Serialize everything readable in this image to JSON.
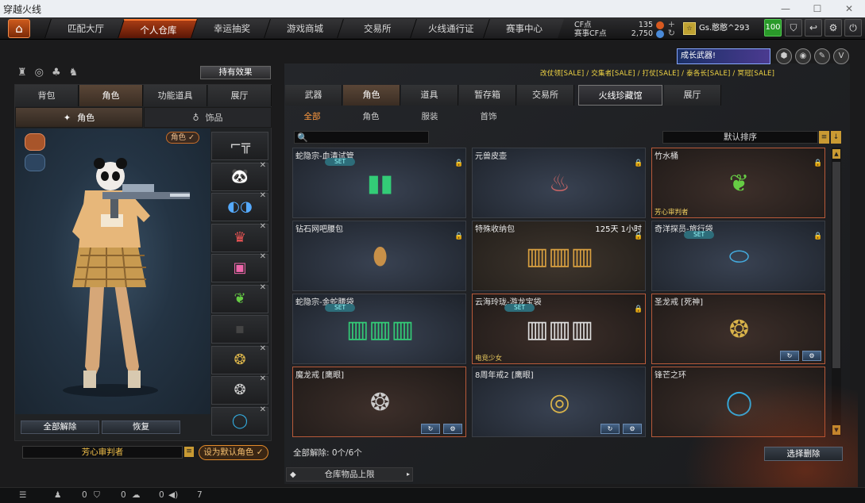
{
  "window": {
    "title": "穿越火线",
    "minimize": "—",
    "maximize": "☐",
    "close": "✕"
  },
  "topnav": {
    "home_icon": "⌂",
    "tabs": [
      "匹配大厅",
      "个人仓库",
      "幸运抽奖",
      "游戏商城",
      "交易所",
      "火线通行证",
      "赛事中心"
    ],
    "active_tab": "个人仓库"
  },
  "currency": {
    "cf_label": "CF点",
    "cf_value": "135",
    "event_label": "赛事CF点",
    "event_value": "2,750",
    "plus": "+",
    "refresh": "↻"
  },
  "user": {
    "name": "Gs.憨憨^293",
    "avatar": "☆",
    "level": "100"
  },
  "toolbar_icons": [
    "shield-icon",
    "back-icon",
    "gear-icon",
    "power-icon"
  ],
  "toolbar_glyphs": [
    "⛉",
    "↩",
    "⚙",
    "⏻"
  ],
  "left": {
    "small_icons": [
      "♜",
      "◎",
      "♣",
      "♞"
    ],
    "effect_button": "持有效果",
    "tabs": [
      "背包",
      "角色",
      "功能道具",
      "展厅"
    ],
    "active_tab": "角色",
    "subtabs": [
      "角色",
      "饰品"
    ],
    "subtab_icons": [
      "✦",
      "♁"
    ],
    "badge": "角色 ✓",
    "release_all": "全部解除",
    "restore": "恢复",
    "character_name": "芳心审判者",
    "name_menu_icon": "≡",
    "set_default": "设为默认角色 ✓",
    "equip_slots": [
      {
        "name": "rifle-slot",
        "glyph": "⌐╦",
        "color": "#ccc",
        "close": ""
      },
      {
        "name": "panda-head-slot",
        "glyph": "🐼",
        "color": "#fff",
        "close": "✕"
      },
      {
        "name": "goggles-slot",
        "glyph": "◐◑",
        "color": "#5af",
        "close": "✕"
      },
      {
        "name": "mask-slot",
        "glyph": "♛",
        "color": "#e55",
        "close": "✕"
      },
      {
        "name": "backpack-slot",
        "glyph": "▣",
        "color": "#e6a",
        "close": "✕"
      },
      {
        "name": "bamboo-slot",
        "glyph": "❦",
        "color": "#6c4",
        "close": "✕"
      },
      {
        "name": "empty-slot",
        "glyph": "▪",
        "color": "#444",
        "close": ""
      },
      {
        "name": "dragon-ring-gold-slot",
        "glyph": "❂",
        "color": "#d9b34a",
        "close": "✕"
      },
      {
        "name": "dragon-ring-silver-slot",
        "glyph": "❂",
        "color": "#ccc",
        "close": "✕"
      },
      {
        "name": "blue-ring-slot",
        "glyph": "◯",
        "color": "#3ad",
        "close": "✕"
      }
    ]
  },
  "right": {
    "promo": "成长武器!",
    "ticker": "改仗领[SALE] / 交集者[SALE] / 打仗[SALE] / 泰各长[SALE] / 冥冠[SALE]",
    "tabs": [
      "武器",
      "角色",
      "道具",
      "暂存箱",
      "交易所",
      "火线珍藏馆",
      "展厅"
    ],
    "active_tab": "角色",
    "subtabs": [
      "全部",
      "角色",
      "服装",
      "首饰"
    ],
    "active_subtab": "全部",
    "search_icon": "🔍",
    "search_placeholder": "",
    "sort": "默认排序",
    "sort_icons": [
      "≡",
      "↓"
    ],
    "items": [
      {
        "name": "蛇隐宗-血清试管",
        "set": "SET",
        "lock": "🔒",
        "glyph": "▮▮",
        "color": "#3c7",
        "time": "",
        "tag": "",
        "style": "",
        "actions": []
      },
      {
        "name": "元兽皮壶",
        "set": "",
        "lock": "🔒",
        "glyph": "♨",
        "color": "#c66",
        "time": "",
        "tag": "",
        "style": "",
        "actions": []
      },
      {
        "name": "竹水桶",
        "set": "",
        "lock": "🔒",
        "glyph": "❦",
        "color": "#6c4",
        "time": "",
        "tag": "芳心审判者",
        "style": "red",
        "actions": []
      },
      {
        "name": "钻石网吧腰包",
        "set": "",
        "lock": "🔒",
        "glyph": "⬮",
        "color": "#c89048",
        "time": "",
        "tag": "",
        "style": "",
        "actions": []
      },
      {
        "name": "特殊收纳包",
        "set": "",
        "lock": "🔒",
        "glyph": "▥▥▥",
        "color": "#d9a040",
        "time": "125天 1小时",
        "tag": "",
        "style": "brown",
        "actions": []
      },
      {
        "name": "奇洋探员-旅行袋",
        "set": "SET",
        "lock": "🔒",
        "glyph": "⬭",
        "color": "#4ad",
        "time": "",
        "tag": "",
        "style": "",
        "actions": []
      },
      {
        "name": "蛇隐宗-金蛇腰袋",
        "set": "SET",
        "lock": "",
        "glyph": "▥▥▥",
        "color": "#3c7",
        "time": "",
        "tag": "",
        "style": "",
        "actions": []
      },
      {
        "name": "云海玲珑-游龙宝袋",
        "set": "SET",
        "lock": "🔒",
        "glyph": "▥▥▥",
        "color": "#ddd",
        "time": "",
        "tag": "电竞少女",
        "style": "red",
        "actions": []
      },
      {
        "name": "圣龙戒 [死神]",
        "set": "",
        "lock": "",
        "glyph": "❂",
        "color": "#d9b34a",
        "time": "",
        "tag": "",
        "style": "red",
        "actions": [
          "↻",
          "⚙"
        ]
      },
      {
        "name": "魔龙戒 [鹰眼]",
        "set": "",
        "lock": "",
        "glyph": "❂",
        "color": "#ccc",
        "time": "",
        "tag": "",
        "style": "red",
        "actions": [
          "↻",
          "⚙"
        ]
      },
      {
        "name": "8周年戒2 [鹰眼]",
        "set": "",
        "lock": "",
        "glyph": "◎",
        "color": "#d9b34a",
        "time": "",
        "tag": "",
        "style": "",
        "actions": [
          "↻",
          "⚙"
        ]
      },
      {
        "name": "锋芒之环",
        "set": "",
        "lock": "",
        "glyph": "◯",
        "color": "#3ad",
        "time": "",
        "tag": "",
        "style": "red",
        "actions": []
      }
    ],
    "scroll_up": "▲",
    "scroll_down": "▼",
    "release_info": "全部解除: 0个/6个",
    "select_delete": "选择删除",
    "capacity": "仓库物品上限",
    "capacity_icon": "◆",
    "capacity_arrow": "▸"
  },
  "statusbar": {
    "list_icon": "☰",
    "mic_icon": "♟",
    "mic": "0",
    "shield_icon": "⛉",
    "shield": "0",
    "chat_icon": "☁",
    "chat": "0",
    "volume_icon": "◀)",
    "volume": "7"
  }
}
